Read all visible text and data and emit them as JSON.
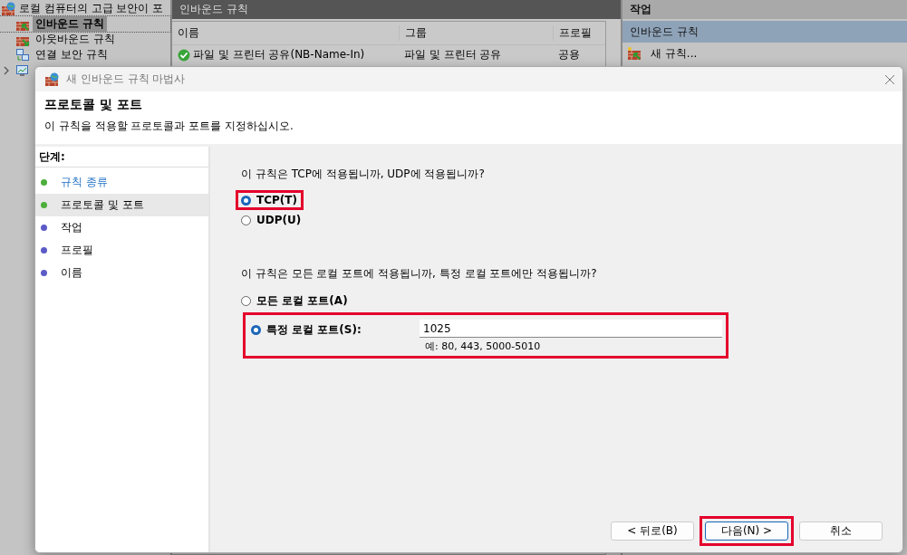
{
  "console": {
    "title": "로컬 컴퓨터의 고급 보안이 포",
    "tree": [
      {
        "label": "인바운드 규칙",
        "kind": "inbound",
        "selected": true
      },
      {
        "label": "아웃바운드 규칙",
        "kind": "outbound",
        "selected": false
      },
      {
        "label": "연결 보안 규칙",
        "kind": "connection",
        "selected": false
      },
      {
        "kind": "monitor",
        "selected": false
      }
    ],
    "rules_pane": {
      "title": "인바운드 규칙",
      "columns": [
        "이름",
        "그룹",
        "프로필"
      ],
      "rows": [
        {
          "name": "파일 및 프린터 공유(NB-Name-In)",
          "group": "파일 및 프린터 공유",
          "profile": "공용",
          "enabled": true
        }
      ]
    },
    "actions": {
      "title": "작업",
      "section": "인바운드 규칙",
      "items": [
        "새 규칙..."
      ]
    }
  },
  "wizard": {
    "title": "새 인바운드 규칙 마법사",
    "heading": "프로토콜 및 포트",
    "subtitle": "이 규칙을 적용할 프로토콜과 포트를 지정하십시오.",
    "steps_title": "단계:",
    "steps": [
      {
        "label": "규칙 종류",
        "completed": true,
        "selected": false
      },
      {
        "label": "프로토콜 및 포트",
        "completed": true,
        "selected": true
      },
      {
        "label": "작업",
        "completed": false,
        "selected": false
      },
      {
        "label": "프로필",
        "completed": false,
        "selected": false
      },
      {
        "label": "이름",
        "completed": false,
        "selected": false
      }
    ],
    "sections": [
      {
        "question": "이 규칙은 TCP에 적용됩니까, UDP에 적용됩니까?",
        "options": [
          {
            "label": "TCP(T)",
            "selected": true,
            "highlighted": true
          },
          {
            "label": "UDP(U)",
            "selected": false,
            "highlighted": false
          }
        ]
      },
      {
        "question": "이 규칙은 모든 로컬 포트에 적용됩니까, 특정 로컬 포트에만 적용됩니까?",
        "options": [
          {
            "label": "모든 로컬 포트(A)",
            "selected": false,
            "highlighted": false
          },
          {
            "label": "특정 로컬 포트(S):",
            "selected": true,
            "highlighted": true,
            "value": "1025",
            "example": "예: 80, 443, 5000-5010"
          }
        ]
      }
    ],
    "buttons": [
      {
        "label": "< 뒤로(B)",
        "default": false,
        "highlighted": false
      },
      {
        "label": "다음(N) >",
        "default": true,
        "highlighted": true
      },
      {
        "label": "취소",
        "default": false,
        "highlighted": false
      }
    ]
  }
}
